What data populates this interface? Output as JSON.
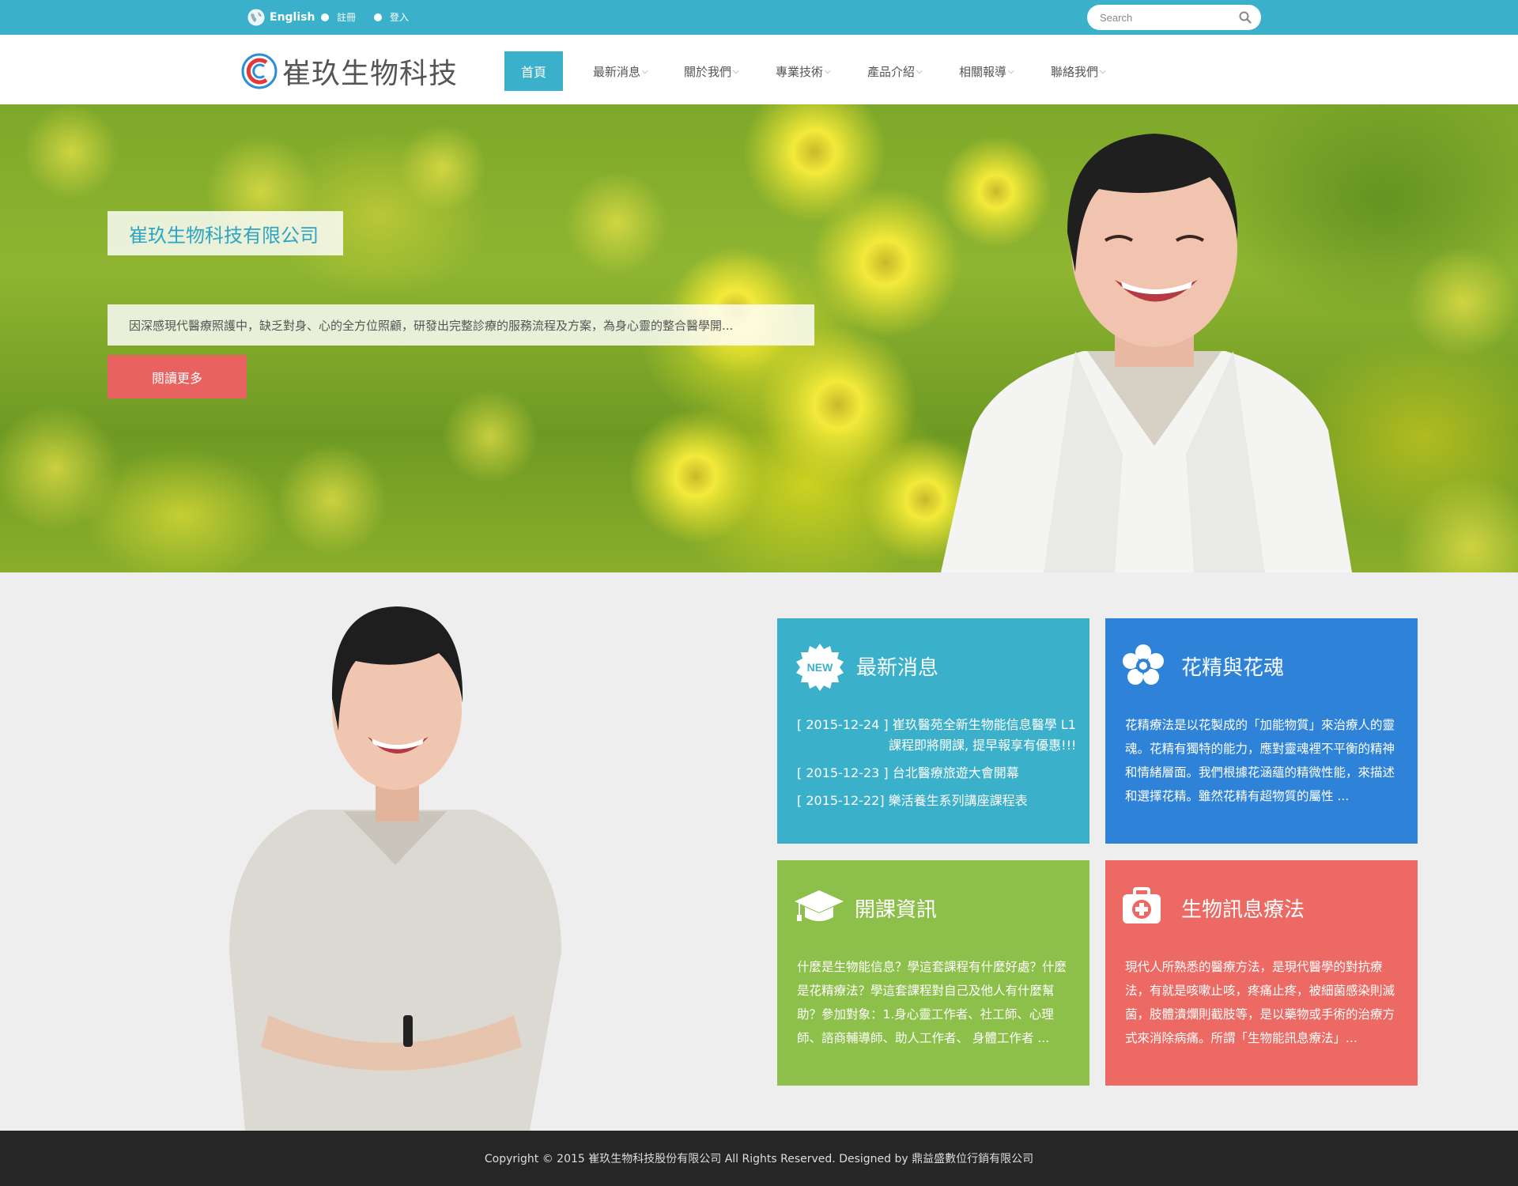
{
  "topbar": {
    "language_label": "English",
    "register_label": "註冊",
    "login_label": "登入",
    "search_placeholder": "Search"
  },
  "header": {
    "logo_text": "崔玖生物科技",
    "nav": [
      {
        "label": "首頁",
        "active": true
      },
      {
        "label": "最新消息"
      },
      {
        "label": "關於我們"
      },
      {
        "label": "專業技術"
      },
      {
        "label": "產品介紹"
      },
      {
        "label": "相關報導"
      },
      {
        "label": "聯絡我們"
      }
    ]
  },
  "hero": {
    "title": "崔玖生物科技有限公司",
    "description": "因深感現代醫療照護中，缺乏對身、心的全方位照顧，研發出完整診療的服務流程及方案，為身心靈的整合醫學開...",
    "button_label": "閱讀更多"
  },
  "cards": {
    "news": {
      "icon": "new-badge-icon",
      "icon_text": "NEW",
      "title": "最新消息",
      "items": [
        {
          "date": "[ 2015-12-24 ]",
          "text": "崔玖醫苑全新生物能信息醫學 L1 課程即將開課, 提早報享有優惠!!!"
        },
        {
          "date": "[ 2015-12-23 ]",
          "text": "台北醫療旅遊大會開幕"
        },
        {
          "date": "[ 2015-12-22]",
          "text": "樂活養生系列講座課程表"
        }
      ]
    },
    "flower": {
      "icon": "flower-icon",
      "title": "花精與花魂",
      "body": "花精療法是以花製成的「加能物質」來治療人的靈魂。花精有獨特的能力，應對靈魂裡不平衡的精神和情緒層面。我們根據花涵蘊的精微性能，來描述和選擇花精。雖然花精有超物質的屬性 ..."
    },
    "course": {
      "icon": "graduation-cap-icon",
      "title": "開課資訊",
      "body": "什麼是生物能信息？學這套課程有什麼好處？什麼是花精療法？學這套課程對自己及他人有什麼幫助？參加對象：1.身心靈工作者、社工師、心理師、諮商輔導師、助人工作者、 身體工作者 ..."
    },
    "bio": {
      "icon": "medical-kit-icon",
      "title": "生物訊息療法",
      "body": "現代人所熟悉的醫療方法，是現代醫學的對抗療法，有就是咳嗽止咳，疼痛止疼，被細菌感染則滅菌，肢體潰爛則截肢等，是以藥物或手術的治療方式來消除病痛。所謂「生物能訊息療法」..."
    }
  },
  "footer": {
    "text": "Copyright © 2015 崔玖生物科技股份有限公司 All Rights Reserved. Designed by 鼎益盛數位行銷有限公司"
  },
  "colors": {
    "accent": "#3bb0cb",
    "news_card": "#3bb0cb",
    "flower_card": "#2e83d9",
    "course_card": "#8dc04a",
    "bio_card": "#ec6a63",
    "hero_button": "#e8625f",
    "footer": "#262626"
  }
}
